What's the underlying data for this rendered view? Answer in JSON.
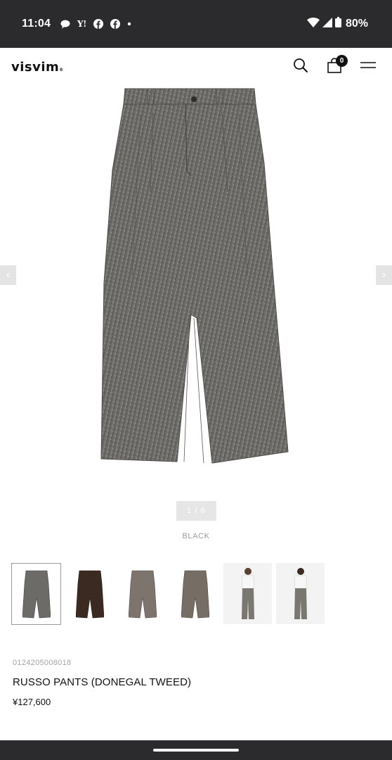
{
  "status_bar": {
    "time": "11:04",
    "notifications": [
      "chat-bubble-icon",
      "yahoo-icon",
      "facebook-icon",
      "facebook-icon",
      "dot-icon"
    ],
    "yahoo_label": "Y!",
    "battery": "80%"
  },
  "header": {
    "logo": "visvim",
    "logo_mark": "®",
    "cart_count": "0"
  },
  "gallery": {
    "prev": "‹",
    "next": "›",
    "pager": "1 / 6",
    "color": "BLACK"
  },
  "product": {
    "sku": "0124205008018",
    "name": "RUSSO PANTS (DONEGAL TWEED)",
    "price": "¥127,600"
  },
  "colors": {
    "status_bg": "#2b2b2d",
    "tweed_grey": "#6d6b67",
    "brown": "#3a2a22",
    "taupe": "#7d756d"
  }
}
